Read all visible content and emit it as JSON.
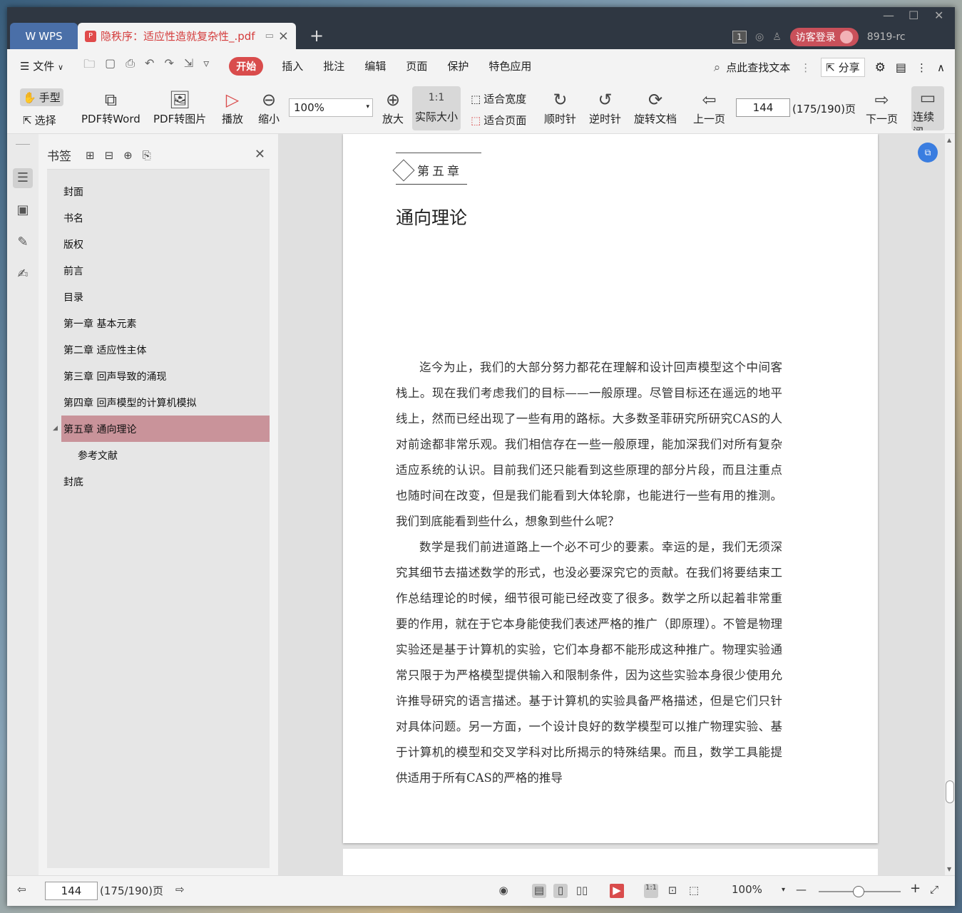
{
  "titlebar": {
    "app_tab": "WPS",
    "doc_tab": "隐秩序：适应性造就复杂性_.pdf",
    "new_tab": "+",
    "page_badge": "1",
    "login": "访客登录",
    "version": "8919-rc",
    "minimize": "—",
    "maximize": "☐",
    "close": "✕"
  },
  "menubar": {
    "file": "文件",
    "tabs": [
      "开始",
      "插入",
      "批注",
      "编辑",
      "页面",
      "保护",
      "特色应用"
    ],
    "search": "点此查找文本",
    "share": "分享"
  },
  "toolbar": {
    "hand": "手型",
    "select": "选择",
    "pdf_to_word": "PDF转Word",
    "pdf_to_image": "PDF转图片",
    "play": "播放",
    "zoom_out": "缩小",
    "zoom_value": "100%",
    "zoom_in": "放大",
    "actual_size": "实际大小",
    "fit_width": "适合宽度",
    "fit_page": "适合页面",
    "clockwise": "顺时针",
    "counterclockwise": "逆时针",
    "rotate_doc": "旋转文档",
    "prev_page": "上一页",
    "page_number": "144",
    "page_total": "(175/190)页",
    "next_page": "下一页",
    "continuous": "连续阅"
  },
  "bookmarks": {
    "title": "书签",
    "items": [
      {
        "label": "封面"
      },
      {
        "label": "书名"
      },
      {
        "label": "版权"
      },
      {
        "label": "前言"
      },
      {
        "label": "目录"
      },
      {
        "label": "第一章  基本元素"
      },
      {
        "label": "第二章  适应性主体"
      },
      {
        "label": "第三章  回声导致的涌现"
      },
      {
        "label": "第四章  回声模型的计算机模拟"
      },
      {
        "label": "第五章  通向理论"
      },
      {
        "label": "参考文献"
      },
      {
        "label": "封底"
      }
    ]
  },
  "document": {
    "chapter_mark": "第五章",
    "chapter_title": "通向理论",
    "paragraphs": [
      "迄今为止，我们的大部分努力都花在理解和设计回声模型这个中间客栈上。现在我们考虑我们的目标——一般原理。尽管目标还在遥远的地平线上，然而已经出现了一些有用的路标。大多数圣菲研究所研究CAS的人对前途都非常乐观。我们相信存在一些一般原理，能加深我们对所有复杂适应系统的认识。目前我们还只能看到这些原理的部分片段，而且注重点也随时间在改变，但是我们能看到大体轮廓，也能进行一些有用的推测。我们到底能看到些什么，想象到些什么呢？",
      "数学是我们前进道路上一个必不可少的要素。幸运的是，我们无须深究其细节去描述数学的形式，也没必要深究它的贡献。在我们将要结束工作总结理论的时候，细节很可能已经改变了很多。数学之所以起着非常重要的作用，就在于它本身能使我们表述严格的推广（即原理）。不管是物理实验还是基于计算机的实验，它们本身都不能形成这种推广。物理实验通常只限于为严格模型提供输入和限制条件，因为这些实验本身很少使用允许推导研究的语言描述。基于计算机的实验具备严格描述，但是它们只针对具体问题。另一方面，一个设计良好的数学模型可以推广物理实验、基于计算机的模型和交叉学科对比所揭示的特殊结果。而且，数学工具能提供适用于所有CAS的严格的推导"
    ]
  },
  "statusbar": {
    "page_number": "144",
    "page_total": "(175/190)页",
    "zoom": "100%"
  }
}
